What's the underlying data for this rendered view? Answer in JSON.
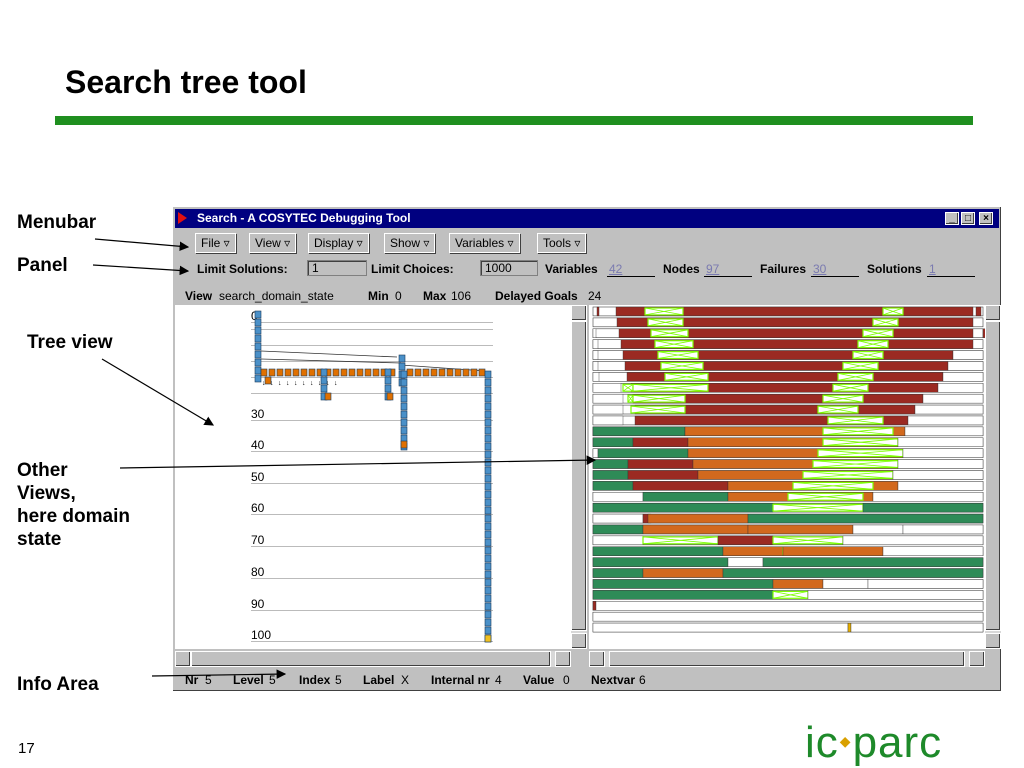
{
  "slide": {
    "title": "Search tree tool",
    "page_number": "17",
    "logo_left": "ic",
    "logo_right": "parc"
  },
  "callouts": [
    "Menubar",
    "Panel",
    "Tree view",
    "Other Views, here domain state",
    "Info Area"
  ],
  "callout_lines": {
    "menubar": "Menubar",
    "panel": "Panel",
    "tree_view": "Tree view",
    "other_1": "Other",
    "other_2": "Views,",
    "other_3": "here domain",
    "other_4": "state",
    "info_area": "Info Area"
  },
  "window": {
    "title": "Search - A COSYTEC Debugging Tool",
    "controls": [
      "_",
      "□",
      "×"
    ]
  },
  "menubar": {
    "items": [
      "File ▿",
      "View ▿",
      "Display ▿",
      "Show ▿",
      "Variables ▿",
      "Tools ▿"
    ]
  },
  "panel": {
    "limit_solutions_label": "Limit Solutions:",
    "limit_solutions_value": "1",
    "limit_choices_label": "Limit Choices:",
    "limit_choices_value": "1000",
    "variables_label": "Variables",
    "variables_value": "42",
    "nodes_label": "Nodes",
    "nodes_value": "97",
    "failures_label": "Failures",
    "failures_value": "30",
    "solutions_label": "Solutions",
    "solutions_value": "1"
  },
  "view_bar": {
    "view_label": "View",
    "view_value": "search_domain_state",
    "min_label": "Min",
    "min_value": "0",
    "max_label": "Max",
    "max_value": "106",
    "delayed_label": "Delayed Goals",
    "delayed_value": "24"
  },
  "tree_depth_labels": [
    "0",
    "30",
    "40",
    "50",
    "60",
    "70",
    "80",
    "90",
    "100"
  ],
  "info_area": {
    "nr_label": "Nr",
    "nr_value": "5",
    "level_label": "Level",
    "level_value": "5",
    "index_label": "Index",
    "index_value": "5",
    "label_label": "Label",
    "label_value": "X",
    "internal_label": "Internal nr",
    "internal_value": "4",
    "value_label": "Value",
    "value_value": "0",
    "nextvar_label": "Nextvar",
    "nextvar_value": "6"
  },
  "colors": {
    "title_rule": "#1f8f1f",
    "title_bar": "#000080",
    "domain_red": "#9b2a22",
    "domain_orange": "#d2691e",
    "domain_green": "#2e8b57",
    "domain_selected": "#7cfc00",
    "node_blue": "#4a90c8",
    "node_orange": "#e07000"
  },
  "domain_rows": [
    "r:4-6|r:23-380|g:52-90|g:290-310|r:383-388",
    "r:24-380|g:55-90|g:280-305",
    "w:0-3|r:26-380|g:58-95|g:270-300|r:390-393",
    "w:0-5|r:28-380|g:62-100|g:265-295",
    "w:0-5|r:30-360|g:65-105|g:260-290|w:360-390",
    "w:0-5|r:32-355|g:68-110|g:250-285|w:355-390",
    "w:0-6|r:34-350|g:72-115|g:245-280|w:350-390",
    "w:0-28|r:38-345|g:30-40|g:40-115|g:240-275|w:345-390",
    "w:0-30|r:40-330|g:35-40|g:40-92|g:230-270|w:330-390",
    "w:0-30|r:42-322|g:38-92|g:225-265|w:322-390",
    "w:0-30|r:42-315|g:235-290|w:315-390",
    "w:0-6|gr:0-92|r:92-312|o:92-312|g:230-300|w:312-390",
    "gr:0-40|r:40-95|o:95-305|g:230-305|w:305-390",
    "w:0-5|gr:5-95|o:95-310|g:225-310|w:310-390",
    "gr:0-35|r:35-100|o:100-305|g:220-305|w:305-390",
    "gr:0-35|r:35-105|o:105-300|g:210-300|w:300-390",
    "gr:0-40|r:40-135|o:135-305|g:200-280|w:305-390",
    "w:0-50|gr:50-135|o:135-280|g:195-270|w:280-390",
    "gr:0-180|g:180-270|gr:270-390",
    "w:0-50|r:50-58|o:55-155|gr:155-390",
    "gr:0-50|o:50-155|o:155-260|w:260-310|w:310-390",
    "w:0-50|g:50-125|r:125-180|g:180-250|w:250-390",
    "gr:0-130|o:130-190|g:190-240|o:190-290|w:290-390",
    "gr:0-135|w:135-170|gr:170-390",
    "gr:0-50|o:50-130|gr:130-390",
    "gr:0-180|o:180-230|w:230-275|w:275-390",
    "gr:0-180|g:180-215|w:215-390",
    "r:0-3|w:3-390",
    "w:0-390",
    "w:0-255|y:255-258|w:258-390"
  ]
}
